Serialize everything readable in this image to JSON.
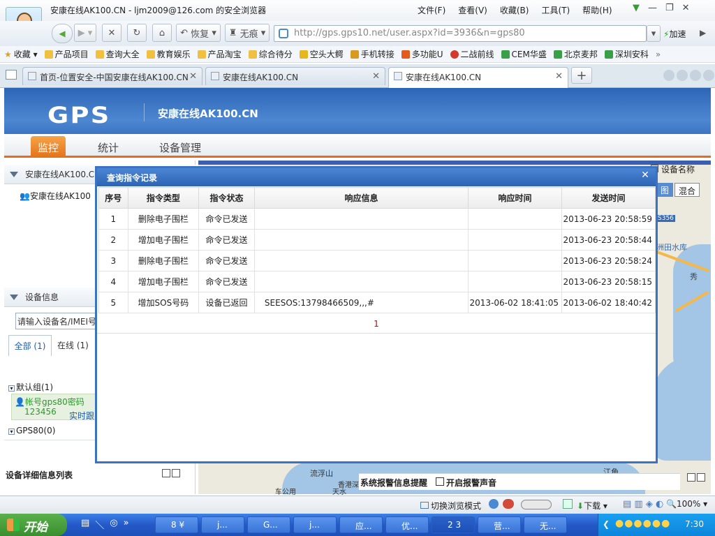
{
  "window": {
    "title": "安康在线AK100.CN - ljm2009@126.com 的安全浏览器",
    "menus": [
      "文件(F)",
      "查看(V)",
      "收藏(B)",
      "工具(T)",
      "帮助(H)"
    ]
  },
  "navbar": {
    "restore_label": "恢复",
    "notrace_label": "无痕",
    "url": "http://gps.gps10.net/user.aspx?id=3936&n=gps80",
    "speedup_label": "加速"
  },
  "favorites": {
    "label": "收藏",
    "items": [
      "产品项目",
      "查询大全",
      "教育娱乐",
      "产品淘宝",
      "综合待分",
      "空头大鳄",
      "手机转接",
      "多功能U",
      "二战前线",
      "CEM华盛",
      "北京麦邦",
      "深圳安科"
    ],
    "more": "»"
  },
  "tabs": [
    "首页-位置安全-中国安康在线AK100.CN",
    "安康在线AK100.CN",
    "安康在线AK100.CN"
  ],
  "site": {
    "logo": "GPS",
    "name": "安康在线AK100.CN",
    "nav": [
      "监控",
      "统计",
      "设备管理"
    ]
  },
  "leftpanel": {
    "tree_title": "安康在线AK100.C",
    "tree_item": "安康在线AK100",
    "device_info_title": "设备信息",
    "search_placeholder": "请输入设备名/IMEI号",
    "filter_all": "全部 (1)",
    "filter_online": "在线 (1)",
    "group_default": "默认组(1)",
    "account_line": "帐号gps80密码",
    "password_line": "123456",
    "realtime_link": "实时跟",
    "group_gps80": "GPS80(0)",
    "detail_list_title": "设备详细信息列表"
  },
  "map": {
    "device_name_checkbox": "设备名称",
    "maptype_map": "图",
    "maptype_hybrid": "混合",
    "label_road": "S356",
    "label_reservoir": "洲田水库",
    "label_east": "秀",
    "label_liufushan": "流浮山",
    "label_bridge": "香港深圳湾公园",
    "label_jiaotou": "江角",
    "label_bottom1": "车公用",
    "label_bottom2": "天水",
    "alarm_panel_title": "系统报警信息提醒",
    "alarm_sound_label": "开启报警声音"
  },
  "dialog": {
    "title": "查询指令记录",
    "columns": [
      "序号",
      "指令类型",
      "指令状态",
      "响应信息",
      "响应时间",
      "发送时间"
    ],
    "rows": [
      {
        "no": "1",
        "type": "删除电子围栏",
        "status": "命令已发送",
        "response": "",
        "resp_time": "",
        "send_time": "2013-06-23 20:58:59"
      },
      {
        "no": "2",
        "type": "增加电子围栏",
        "status": "命令已发送",
        "response": "",
        "resp_time": "",
        "send_time": "2013-06-23 20:58:44"
      },
      {
        "no": "3",
        "type": "删除电子围栏",
        "status": "命令已发送",
        "response": "",
        "resp_time": "",
        "send_time": "2013-06-23 20:58:24"
      },
      {
        "no": "4",
        "type": "增加电子围栏",
        "status": "命令已发送",
        "response": "",
        "resp_time": "",
        "send_time": "2013-06-23 20:58:15"
      },
      {
        "no": "5",
        "type": "增加SOS号码",
        "status": "设备已返回",
        "response": "SEESOS:13798466509,,,#",
        "resp_time": "2013-06-02 18:41:05",
        "send_time": "2013-06-02 18:40:42"
      }
    ],
    "page": "1"
  },
  "statusbar": {
    "switch_mode": "切换浏览模式",
    "download": "下载",
    "zoom": "100%"
  },
  "taskbar": {
    "start": "开始",
    "items": [
      "8 ¥",
      "j...",
      "G...",
      "j...",
      "应...",
      "优...",
      "2 3",
      "营...",
      "无..."
    ],
    "time": "7:30"
  },
  "colors": {
    "accent": "#3a72c4",
    "nav_active": "#e3741c",
    "header": "#2d66b6"
  }
}
